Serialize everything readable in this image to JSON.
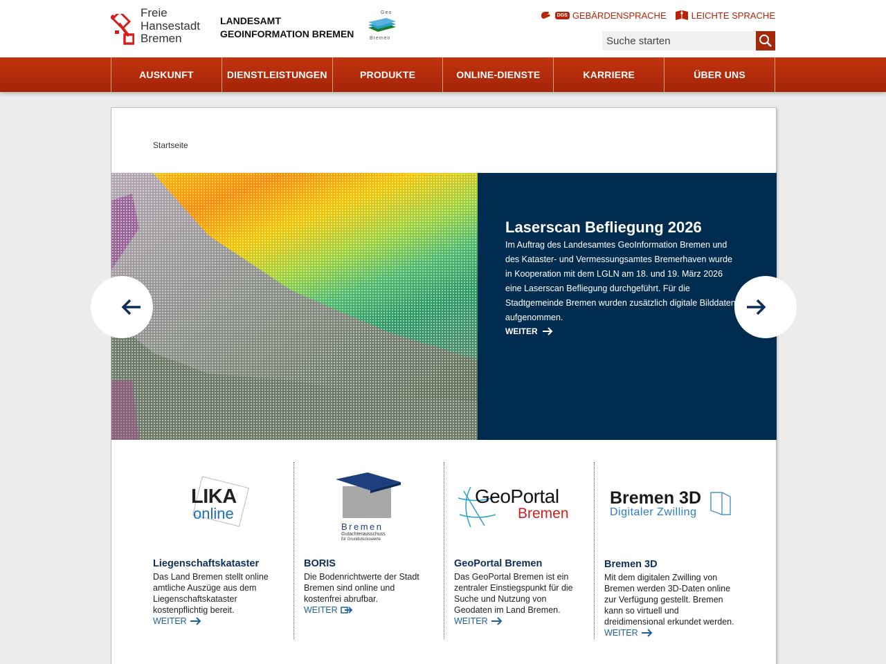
{
  "header": {
    "city_line1": "Freie",
    "city_line2": "Hansestadt",
    "city_line3": "Bremen",
    "agency_line1": "LANDESAMT",
    "agency_line2": "GEOINFORMATION BREMEN",
    "geo_logo_top": "Geo",
    "geo_logo_bottom": "Bremen",
    "links": {
      "sign_language": "GEBÄRDENSPRACHE",
      "sign_badge": "DGS",
      "easy_language": "LEICHTE SPRACHE"
    },
    "search": {
      "placeholder": "Suche starten"
    }
  },
  "nav": {
    "items": [
      {
        "label": "AUSKUNFT"
      },
      {
        "label": "DIENSTLEISTUNGEN"
      },
      {
        "label": "PRODUKTE"
      },
      {
        "label": "ONLINE-DIENSTE"
      },
      {
        "label": "KARRIERE"
      },
      {
        "label": "ÜBER UNS"
      }
    ]
  },
  "breadcrumb": {
    "home": "Startseite"
  },
  "slider": {
    "title": "Laserscan Befliegung 2026",
    "text": "Im Auftrag des Landesamtes GeoInformation Bremen und des Kataster- und Vermessungsamtes Bremerhaven wurde in Kooperation mit dem LGLN am 18. und 19. März 2026 eine Laserscan Befliegung durchgeführt. Für die Stadtgemeinde Bremen wurden zusätzlich digitale Bilddaten aufgenommen.",
    "more": "WEITER",
    "colors": {
      "box": "#002c4f"
    }
  },
  "teasers": [
    {
      "logo_line1": "LIKA",
      "logo_line2": "online",
      "title": "Liegenschaftskataster",
      "text": "Das Land Bremen stellt online amtliche Auszüge aus dem Liegenschaftskataster kostenpflichtig bereit.",
      "more": "WEITER"
    },
    {
      "logo_line1": "Bremen",
      "logo_line2": "Gutachterausschuss",
      "logo_line3": "für Grundstückswerte",
      "title": "BORIS",
      "text": "Die Bodenrichtwerte der Stadt Bremen sind online und kostenfrei abrufbar.",
      "more": "WEITER"
    },
    {
      "logo_line1": "GeoPortal",
      "logo_line2": "Bremen",
      "title": "GeoPortal Bremen",
      "text": "Das GeoPortal Bremen ist ein zentraler Einstiegspunkt für die Suche und Nutzung von Geodaten im Land Bremen.",
      "more": "WEITER"
    },
    {
      "logo_line1": "Bremen 3D",
      "logo_line2": "Digitaler Zwilling",
      "title": "Bremen 3D",
      "text": "Mit dem digitalen Zwilling von Bremen werden 3D-Daten online zur Verfügung gestellt. Bremen kann so virtuell und dreidimensional erkundet werden.",
      "more": "WEITER"
    }
  ],
  "colors": {
    "brand_red": "#b5250a",
    "nav_red": "#a42408",
    "navy": "#0d2f57",
    "link_blue": "#1f5f9c"
  }
}
